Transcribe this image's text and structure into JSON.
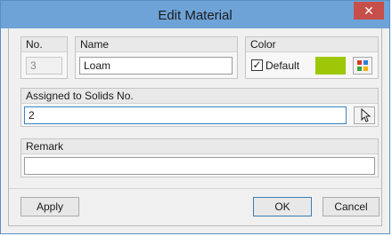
{
  "window": {
    "title": "Edit Material",
    "close_glyph": "✕"
  },
  "groups": {
    "no": {
      "label": "No.",
      "value": "3"
    },
    "name": {
      "label": "Name",
      "value": "Loam"
    },
    "color": {
      "label": "Color",
      "default_label": "Default",
      "default_checked": true,
      "swatch_color": "#9dc707",
      "picker_icon": "color-palette-icon"
    },
    "assigned": {
      "label": "Assigned to Solids No.",
      "value": "2",
      "pick_icon": "select-cursor-icon"
    },
    "remark": {
      "label": "Remark",
      "value": ""
    }
  },
  "buttons": {
    "apply": "Apply",
    "ok": "OK",
    "cancel": "Cancel"
  }
}
